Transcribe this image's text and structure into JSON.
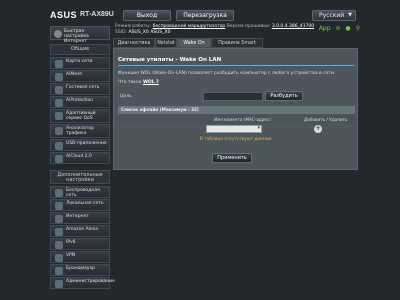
{
  "header": {
    "logo": "ASUS",
    "model": "RT-AX89U",
    "exit_label": "Выход",
    "reboot_label": "Перезагрузка",
    "language": "Русский"
  },
  "status": {
    "mode_label": "Режим работы:",
    "mode_value": "беспроводной маршрутизатор",
    "firmware_label": "Версия прошивки:",
    "firmware_value": "3.0.0.4.386_41700",
    "ssid_label": "SSID:",
    "ssid_1": "ASUS_X0",
    "ssid_2": "ASUS_X0",
    "app_label": "App"
  },
  "sidebar": {
    "quick_setup": "Быстрая настройка Интернет",
    "general_heading": "Общие",
    "items": [
      {
        "label": "Карта сети"
      },
      {
        "label": "AiMesh"
      },
      {
        "label": "Гостевая сеть"
      },
      {
        "label": "AiProtection"
      },
      {
        "label": "Адаптивный сервис QoS"
      },
      {
        "label": "Анализатор трафика"
      },
      {
        "label": "USB-приложение"
      },
      {
        "label": "AiCloud 2.0"
      }
    ],
    "advanced_heading": "Дополнительные настройки",
    "advanced_items": [
      {
        "label": "Беспроводная сеть"
      },
      {
        "label": "Локальная сеть"
      },
      {
        "label": "Интернет"
      },
      {
        "label": "Amazon Alexa"
      },
      {
        "label": "IPv6"
      },
      {
        "label": "VPN"
      },
      {
        "label": "Брандмауэр"
      },
      {
        "label": "Администрирование"
      }
    ]
  },
  "tabs": [
    {
      "label": "Диагностика сети"
    },
    {
      "label": "Netstat"
    },
    {
      "label": "Wake On LAN"
    },
    {
      "label": "Правила Smart Connect"
    }
  ],
  "panel": {
    "title": "Сетевые утилиты - Wake On LAN",
    "description": "Функция WOL (Wake-On-LAN) позволяет разбудить компьютер с любого устройства в сети.",
    "link_prefix": "Что такое",
    "link_text": "WOL ?",
    "target_label": "Цель",
    "target_value": "",
    "wake_button": "Разбудить",
    "list_title": "Список офлайн (Максимум : 32)",
    "col_name_mac": "Имя клиента (MAC-адрес)",
    "col_action": "Добавить / Удалить",
    "select_value": "",
    "empty_message": "В таблице отсутствуют данные.",
    "apply_button": "Применить"
  }
}
